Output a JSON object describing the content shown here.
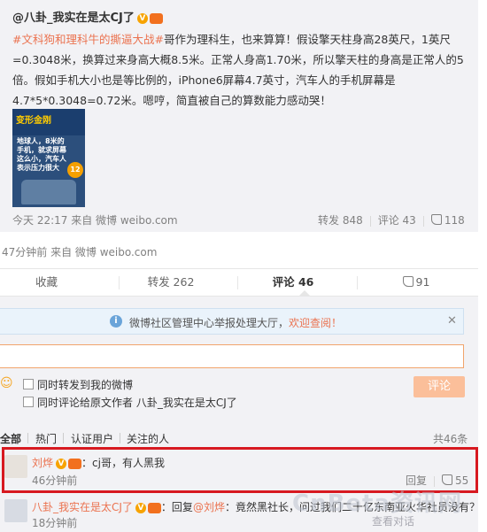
{
  "original_post": {
    "author": "@八卦_我实在是太CJ了",
    "v_badge": "V",
    "text_link": "#文科狗和理科牛的撕逼大战#",
    "text_body": "哥作为理科生，也来算算！假设擎天柱身高28英尺，1英尺=0.3048米，换算过来身高大概8.5米。正常人身高1.70米，所以擎天柱的身高是正常人的5倍。假如手机大小也是等比例的，iPhone6屏幕4.7英寸，汽车人的手机屏幕是4.7*5*0.3048=0.72米。嗯哼，简直被自己的算数能力感动哭！",
    "image": {
      "logo_text": "变形金刚",
      "caption": "地球人，8米的手机，就求屏幕这么小，汽车人表示压力很大",
      "number": "12"
    },
    "time": "今天 22:17",
    "source": "来自 微博 weibo.com",
    "repost": "转发 848",
    "comment": "评论 43",
    "like": "118"
  },
  "post_meta": {
    "time_source": "47分钟前 来自 微博 weibo.com"
  },
  "action_bar": {
    "favorite": "收藏",
    "repost": "转发 262",
    "comment": "评论 46",
    "like": "91"
  },
  "notice": {
    "icon": "i",
    "text": "微博社区管理中心举报处理大厅，",
    "link": "欢迎查阅！",
    "close": "✕"
  },
  "composer": {
    "input_value": "",
    "checkbox1": "同时转发到我的微博",
    "checkbox2": "同时评论给原文作者 八卦_我实在是太CJ了",
    "send": "评论"
  },
  "filters": {
    "all": "全部",
    "hot": "热门",
    "verified": "认证用户",
    "following": "关注的人",
    "total": "共46条"
  },
  "comments": [
    {
      "name": "刘烨",
      "text": "：cj哥，有人黑我",
      "time": "46分钟前",
      "reply": "回复",
      "likes": "55"
    },
    {
      "name": "八卦_我实在是太CJ了",
      "reply_prefix": "：回复",
      "mention": "@刘烨",
      "text": "：竟然黑社长，问过我们二十亿东南亚火华社员没有？",
      "time": "18分钟前",
      "reply": "回复",
      "likes": ""
    }
  ],
  "watermark": {
    "main": "CnBeta资讯网",
    "sub": "查看对话"
  },
  "colors": {
    "accent": "#eb7350",
    "highlight": "#d71920",
    "send_button": "#fbbf9a",
    "notice_bg": "#eaf3fb"
  }
}
